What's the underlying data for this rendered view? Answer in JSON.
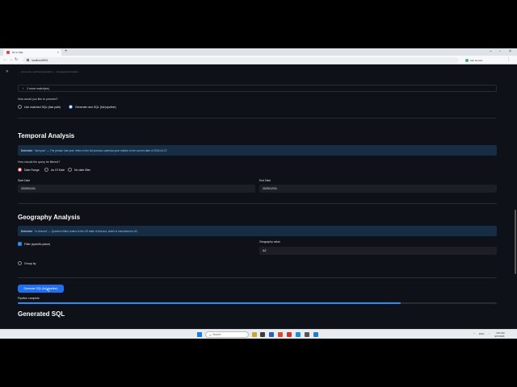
{
  "browser": {
    "tab_title": "NL to SQL",
    "url": "localhost:8501",
    "profile_name": "Ask Gemini"
  },
  "app": {
    "faded_top_text": "… previously matched questions — Geography Analysis …",
    "expander_label": "2 more match(es)",
    "proceed": {
      "question": "How would you like to proceed?",
      "options": [
        "Use matched SQL (fast path)",
        "Generate new SQL (full pipeline)"
      ],
      "selected": "Generate new SQL (full pipeline)"
    },
    "temporal": {
      "heading": "Temporal Analysis",
      "info_prefix": "Detected:",
      "info_text": "\"last year\" — The phrase 'last year' refers to the full previous calendar year relative to the current date of 2026-04-27.",
      "filter_question": "How should the query be filtered?",
      "filter_options": [
        "Date Range",
        "As Of Date",
        "No date filter"
      ],
      "filter_selected": "Date Range",
      "start_label": "Start Date",
      "start_value": "2025/01/01",
      "end_label": "End Date",
      "end_value": "2025/12/31"
    },
    "geography": {
      "heading": "Geography Analysis",
      "info_prefix": "Detected:",
      "info_text": "\"in Arizona\" — Question filters orders to the US state of Arizona, which is normalized to AZ.",
      "filter_label": "Filter (specific place)",
      "filter_checked": true,
      "value_label": "Geography value",
      "value": "AZ",
      "group_label": "Group by",
      "group_checked": false
    },
    "generate_button": "Generate SQL (full pipeline)",
    "progress": {
      "label": "Pipeline complete",
      "fraction": 0.8
    },
    "generated_heading": "Generated SQL"
  },
  "taskbar": {
    "search_placeholder": "Search",
    "time": "2:01 AM",
    "date": "4/27/2026",
    "language": "ENG"
  },
  "colors": {
    "app_bg": "#0e1117",
    "primary": "#1f6ff0",
    "info_bg": "#172d43",
    "info_text": "#8ec3f5",
    "progress": "#2d8cf0"
  }
}
